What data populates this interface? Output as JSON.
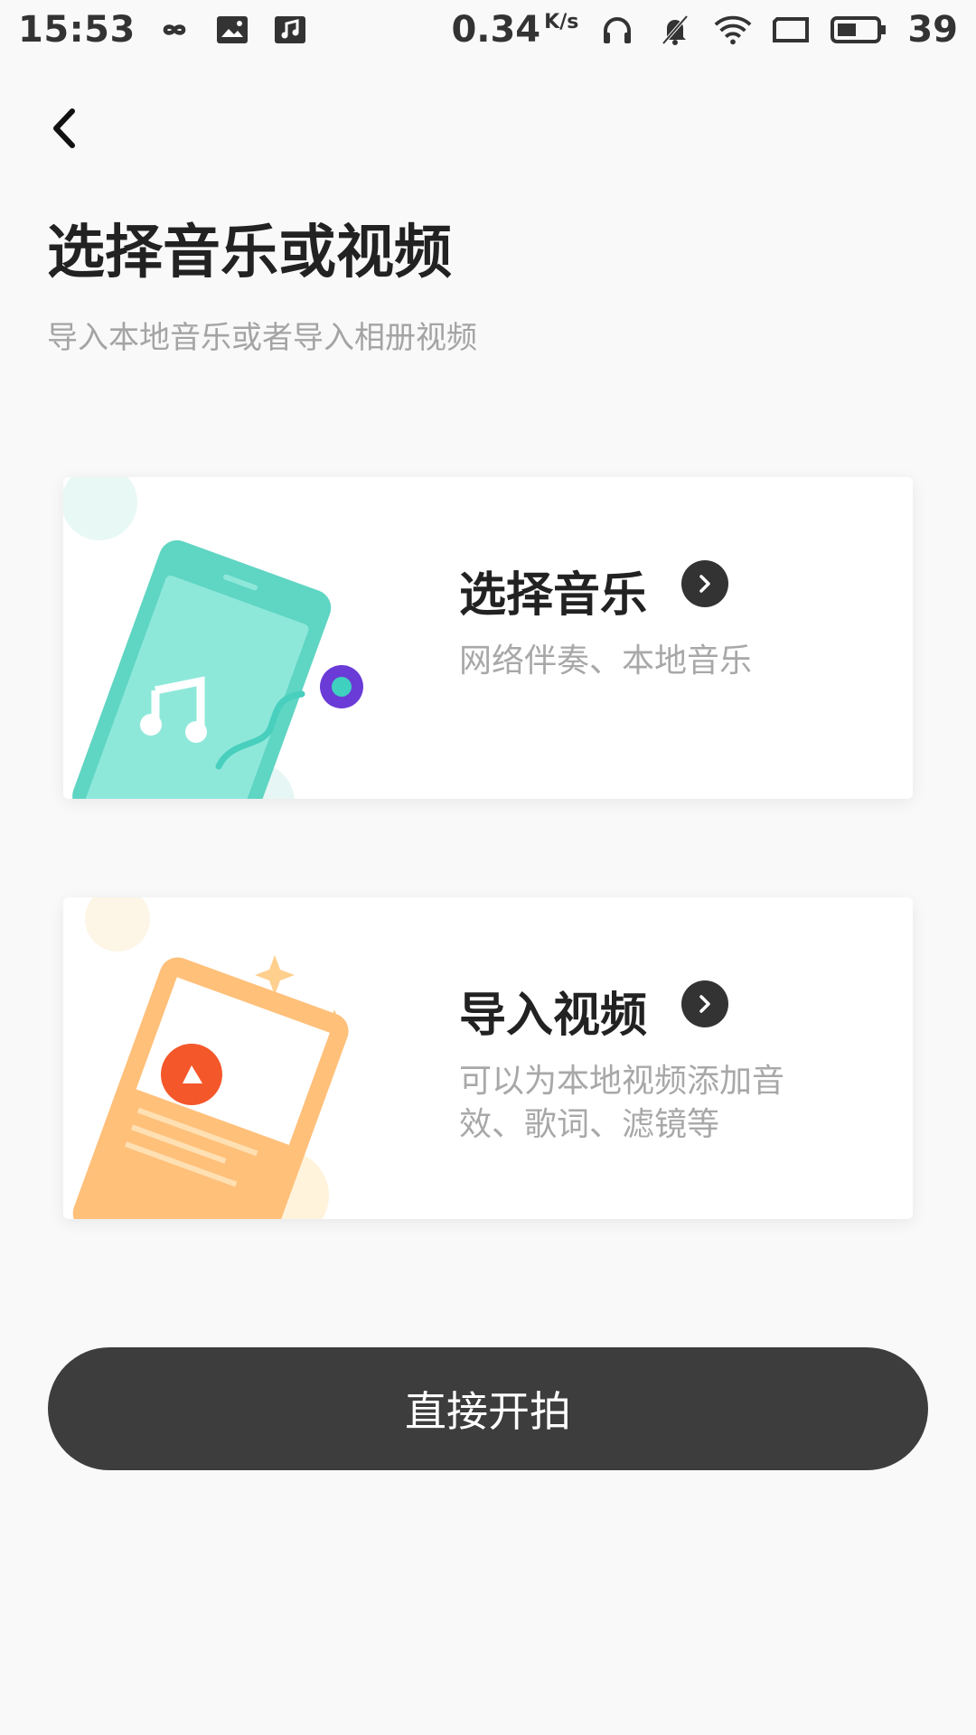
{
  "status_bar": {
    "time": "15:53",
    "speed_value": "0.34",
    "speed_unit": "K/s",
    "battery": "39",
    "icons": [
      "infinity-icon",
      "image-icon",
      "music-icon",
      "headphones-icon",
      "bell-muted-icon",
      "wifi-icon",
      "screen-icon",
      "battery-icon"
    ]
  },
  "header": {
    "title": "选择音乐或视频",
    "subtitle": "导入本地音乐或者导入相册视频"
  },
  "cards": {
    "music": {
      "title": "选择音乐",
      "description": "网络伴奏、本地音乐"
    },
    "video": {
      "title": "导入视频",
      "description": "可以为本地视频添加音效、歌词、滤镜等"
    }
  },
  "start_button": {
    "label": "直接开拍"
  },
  "colors": {
    "music_accent": "#5dd5c4",
    "video_accent": "#ffb469",
    "play_red": "#f4572a",
    "button_dark": "#3d3d3d"
  }
}
